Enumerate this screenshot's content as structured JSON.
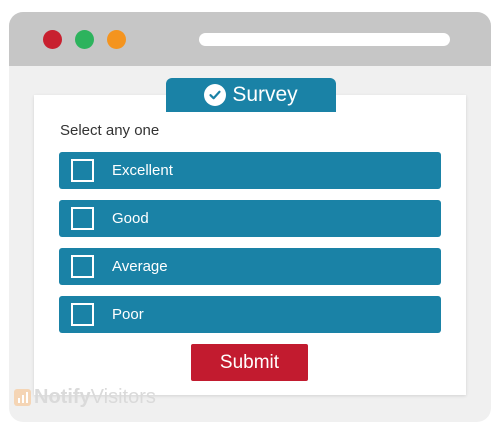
{
  "colors": {
    "option_bg": "#1a82a6",
    "tab_bg": "#1a82a6",
    "submit_bg": "#c21b2f",
    "dot_red": "#c8202f",
    "dot_green": "#2db35d",
    "dot_orange": "#f4941f"
  },
  "survey": {
    "tab_label": "Survey",
    "prompt": "Select any one",
    "options": [
      {
        "label": "Excellent",
        "checked": false
      },
      {
        "label": "Good",
        "checked": false
      },
      {
        "label": "Average",
        "checked": false
      },
      {
        "label": "Poor",
        "checked": false
      }
    ],
    "submit_label": "Submit"
  },
  "watermark": {
    "brand_part1": "Notify",
    "brand_part2": "Visitors"
  },
  "icons": {
    "tab_icon": "check-circle-icon",
    "option_icon": "checkbox-icon",
    "watermark_icon": "bar-chart-logo-icon"
  }
}
